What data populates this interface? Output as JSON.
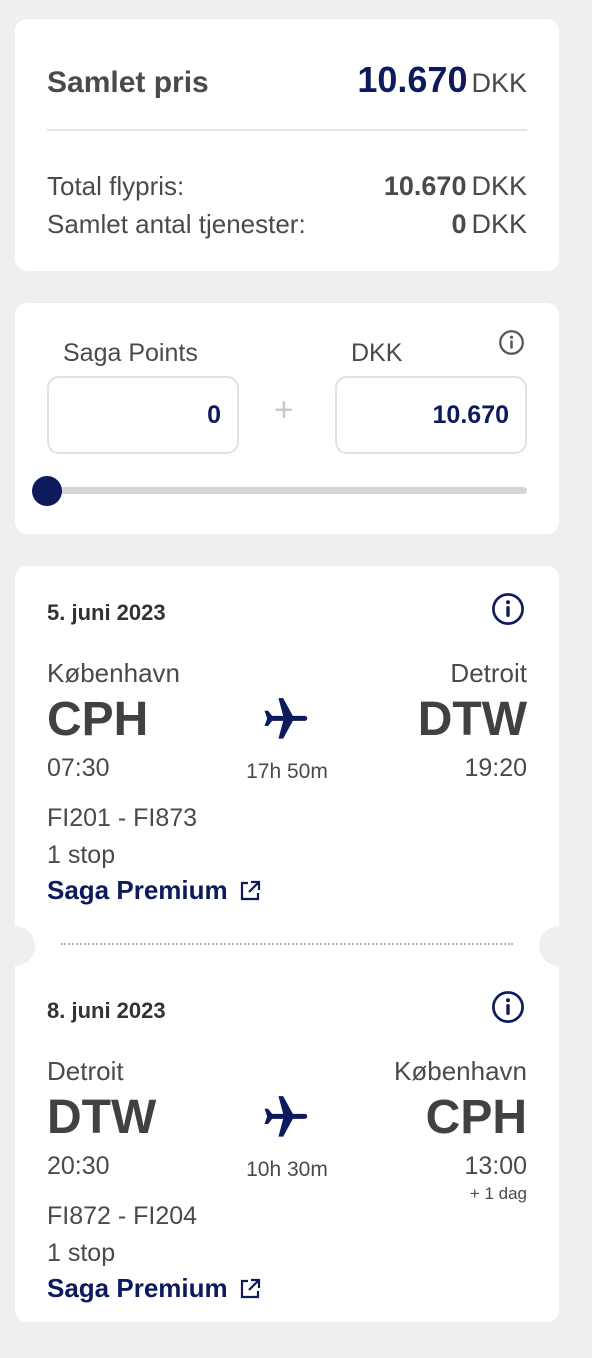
{
  "summary": {
    "title": "Samlet pris",
    "total_amount": "10.670",
    "currency": "DKK",
    "rows": [
      {
        "label": "Total flypris:",
        "amount": "10.670",
        "currency": "DKK"
      },
      {
        "label": "Samlet antal tjenester:",
        "amount": "0",
        "currency": "DKK"
      }
    ]
  },
  "points": {
    "points_label": "Saga Points",
    "dkk_label": "DKK",
    "points_value": "0",
    "dkk_value": "10.670",
    "plus": "+",
    "slider_fraction": 0.0
  },
  "legs": [
    {
      "date": "5. juni 2023",
      "from_city": "København",
      "from_code": "CPH",
      "to_city": "Detroit",
      "to_code": "DTW",
      "depart": "07:30",
      "arrive": "19:20",
      "duration": "17h 50m",
      "arrive_note": "",
      "flights": "FI201 - FI873",
      "stops": "1 stop",
      "fare": "Saga Premium"
    },
    {
      "date": "8. juni 2023",
      "from_city": "Detroit",
      "from_code": "DTW",
      "to_city": "København",
      "to_code": "CPH",
      "depart": "20:30",
      "arrive": "13:00",
      "duration": "10h 30m",
      "arrive_note": "+ 1 dag",
      "flights": "FI872 - FI204",
      "stops": "1 stop",
      "fare": "Saga Premium"
    }
  ],
  "colors": {
    "brand_navy": "#0d1a5c",
    "text": "#4a4a4a",
    "background": "#efeff1"
  },
  "icons": {
    "info": "info-icon",
    "plane": "plane-icon",
    "external": "external-link-icon"
  }
}
